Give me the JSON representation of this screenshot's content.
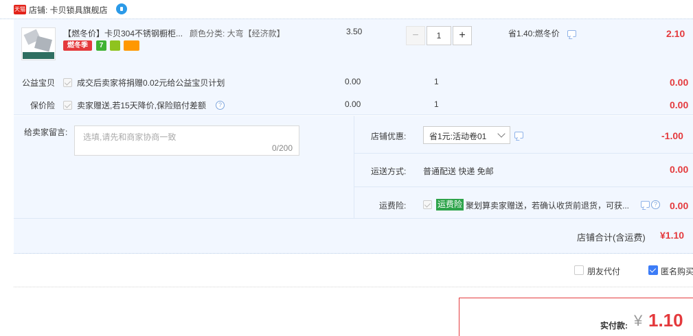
{
  "shop": {
    "logo_text": "天猫",
    "name": "店铺: 卡贝锁具旗舰店"
  },
  "item": {
    "title": "【燃冬价】卡贝304不锈钢橱柜...",
    "sku": "颜色分类: 大弯【经济款】",
    "unit_price": "3.50",
    "quantity": "1",
    "discount_note": "省1.40:燃冬价",
    "subtotal": "2.10",
    "badges": [
      "燃冬季",
      "7",
      "",
      ""
    ],
    "badge_colors": {
      "promo": "#e4393c",
      "seven_day": "#3fb233",
      "guarantee": "#8fc31f",
      "card": "#ff9800"
    }
  },
  "services": [
    {
      "label": "公益宝贝",
      "desc": "成交后卖家将捐赠0.02元给公益宝贝计划",
      "price": "0.00",
      "qty": "1",
      "subtotal": "0.00"
    },
    {
      "label": "保价险",
      "desc": "卖家赠送,若15天降价,保险赔付差额",
      "price": "0.00",
      "qty": "1",
      "subtotal": "0.00"
    }
  ],
  "message": {
    "label": "给卖家留言:",
    "placeholder": "选填,请先和商家协商一致",
    "count": "0/200"
  },
  "shop_discount": {
    "label": "店铺优惠:",
    "selected": "省1元:活动卷01",
    "amount": "-1.00"
  },
  "shipping": {
    "label": "运送方式:",
    "method": "普通配送 快递 免邮",
    "amount": "0.00"
  },
  "freight_insurance": {
    "label": "运费险:",
    "tag": "运费险",
    "desc": "聚划算卖家赠送，若确认收货前退货，可获...",
    "amount": "0.00"
  },
  "shop_total": {
    "label": "店铺合计(含运费)",
    "amount": "¥1.10"
  },
  "options": {
    "friend_pay": "朋友代付",
    "anonymous": "匿名购买"
  },
  "payment": {
    "label": "实付款:",
    "currency": "¥",
    "amount": "1.10"
  },
  "colors": {
    "accent_red": "#e4393c",
    "panel_bg": "#f2f7ff",
    "checkbox_blue": "#3c7cf7"
  }
}
